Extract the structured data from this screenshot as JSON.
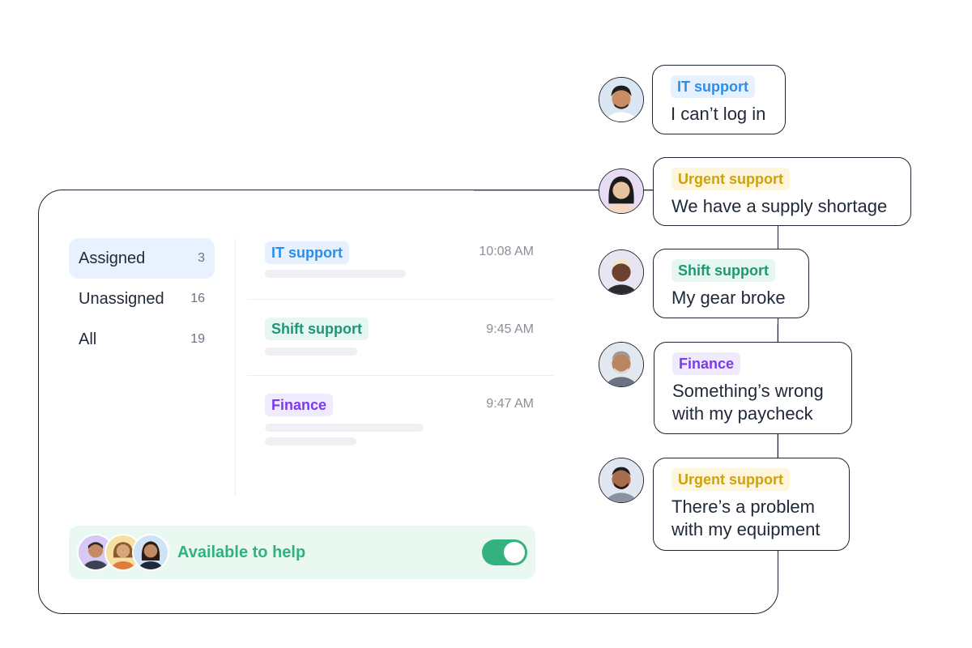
{
  "sidebar": {
    "items": [
      {
        "label": "Assigned",
        "count": "3"
      },
      {
        "label": "Unassigned",
        "count": "16"
      },
      {
        "label": "All",
        "count": "19"
      }
    ]
  },
  "conversations": [
    {
      "tag": "IT support",
      "time": "10:08 AM",
      "color": "#2d8ee8"
    },
    {
      "tag": "Shift support",
      "time": "9:45 AM",
      "color": "#1f9777"
    },
    {
      "tag": "Finance",
      "time": "9:47 AM",
      "color": "#7c3aed"
    }
  ],
  "availability": {
    "label": "Available to help",
    "toggle_on": true,
    "accent": "#33b27f"
  },
  "chats": [
    {
      "tag": "IT support",
      "message": "I can’t log in",
      "color": "#2d8ee8",
      "avatar_icon": "person-avatar-icon"
    },
    {
      "tag": "Urgent support",
      "message": "We have a supply shortage",
      "color": "#d1a10a",
      "avatar_icon": "person-avatar-icon"
    },
    {
      "tag": "Shift support",
      "message": "My gear broke",
      "color": "#1f9777",
      "avatar_icon": "person-avatar-icon"
    },
    {
      "tag": "Finance",
      "message": "Something’s wrong with my paycheck",
      "color": "#7c3aed",
      "avatar_icon": "person-avatar-icon"
    },
    {
      "tag": "Urgent support",
      "message": "There’s a problem with my equipment",
      "color": "#d1a10a",
      "avatar_icon": "person-avatar-icon"
    }
  ]
}
